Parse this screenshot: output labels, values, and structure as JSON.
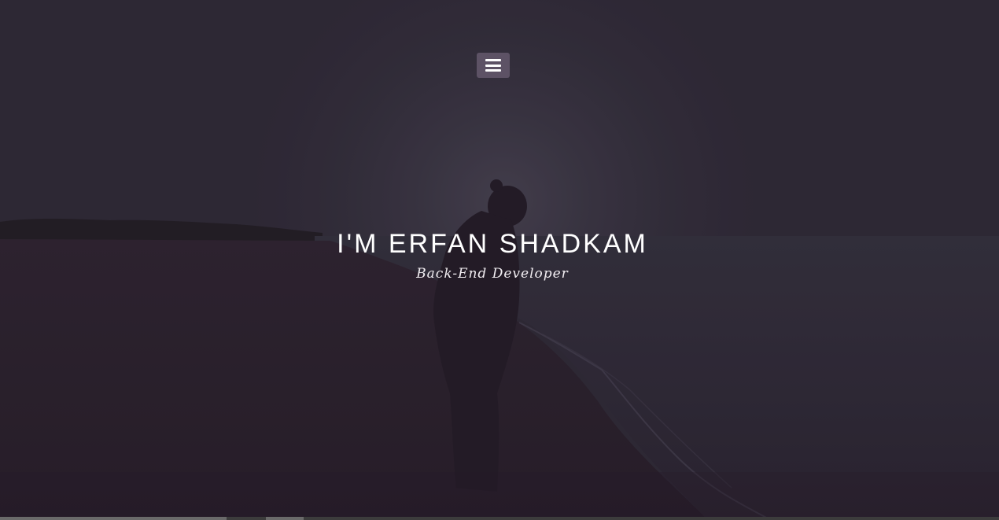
{
  "hero": {
    "title": "I'M ERFAN SHADKAM",
    "subtitle": "Back-End Developer",
    "background_image": "silhouette-on-beach-at-dusk"
  },
  "nav": {
    "menu_icon": "hamburger-menu-icon",
    "menu_button_color": "#5d5265"
  },
  "colors": {
    "text": "#ffffff",
    "overlay": "#2a2330"
  }
}
